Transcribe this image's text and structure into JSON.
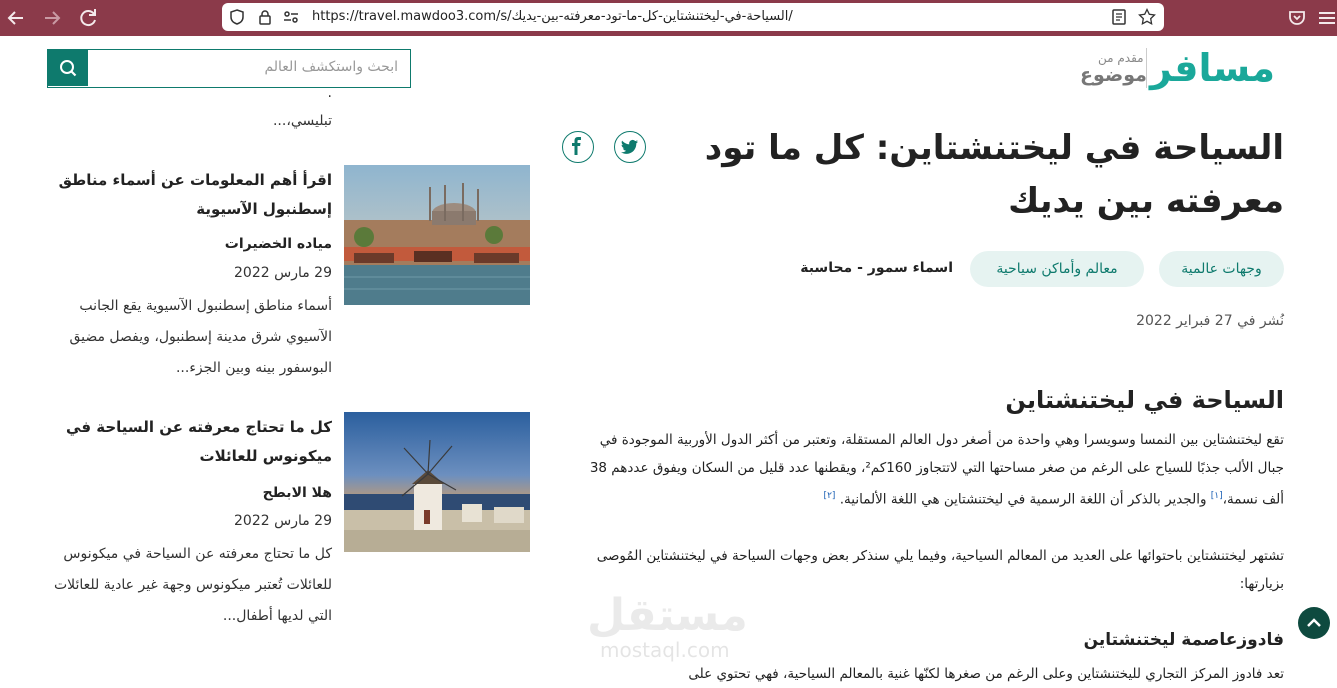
{
  "browser": {
    "url": "https://travel.mawdoo3.com/s/السياحة-في-ليختنشتاين-كل-ما-تود-معرفته-بين-يديك/"
  },
  "header": {
    "logo_main": "مسافر",
    "logo_sub_top": "مقدم من",
    "logo_sub_brand": "موضوع",
    "search_placeholder": "ابحث واستكشف العالم"
  },
  "article": {
    "title": "السياحة في ليختنشتاين: كل ما تود معرفته بين يديك",
    "tags": [
      "وجهات عالمية",
      "معالم وأماكن سياحية"
    ],
    "author": "اسماء سمور - محاسبة",
    "published": "نُشر في 27 فبراير 2022",
    "section_heading": "السياحة في ليختنشتاين",
    "para1": "تقع ليختنشتاين بين النمسا وسويسرا وهي واحدة من أصغر دول العالم المستقلة، وتعتبر من أكثر الدول الأوربية الموجودة في جبال الألب جذبًا للسياح على الرغم من صغر مساحتها التي لاتتجاوز 160كم²، ويقطنها عدد قليل من السكان ويفوق عددهم 38 ألف نسمة،",
    "ref1": "[١]",
    "para1_cont": " والجدير بالذكر أن اللغة الرسمية في ليختنشتاين هي اللغة الألمانية.",
    "ref2": "[٢]",
    "para2": "تشتهر ليختنشتاين باحتوائها على العديد من المعالم السياحية، وفيما يلي سنذكر بعض وجهات السياحة في ليختنشتاين المُوصى بزيارتها:",
    "subheading": "فادوزعاصمة ليختنشتاين",
    "para3": "تعد فادوز المركز التجاري لليختنشتاين وعلى الرغم من صغرها لكنّها غنية بالمعالم السياحية، فهي تحتوي على"
  },
  "sidebar": {
    "prev_dots": ".",
    "prev_excerpt_tail": "تبليسي،...",
    "cards": [
      {
        "title": "اقرأ أهم المعلومات عن أسماء مناطق إسطنبول الآسيوية",
        "author": "مياده الخضيرات",
        "date": "29 مارس 2022",
        "excerpt": "أسماء مناطق إسطنبول الآسيوية يقع الجانب الآسيوي شرق مدينة إسطنبول، ويفصل مضيق البوسفور بينه وبين الجزء..."
      },
      {
        "title": "كل ما تحتاج معرفته عن السياحة في ميكونوس للعائلات",
        "author": "هلا الابطح",
        "date": "29 مارس 2022",
        "excerpt": "كل ما تحتاج معرفته عن السياحة في ميكونوس للعائلات تُعتبر ميكونوس وجهة غير عادية للعائلات التي لديها أطفال..."
      }
    ]
  },
  "watermark": {
    "arabic": "مستقل",
    "latin": "mostaql.com"
  },
  "colors": {
    "accent": "#0e7a6d",
    "logo": "#1aa89a",
    "chrome": "#8b3a4a",
    "tag_bg": "#e6f3f1"
  },
  "icons": {
    "back": "arrow-left-icon",
    "forward": "arrow-right-icon",
    "reload": "reload-icon",
    "shield": "shield-icon",
    "lock": "lock-icon",
    "permissions": "permissions-icon",
    "reader": "reader-view-icon",
    "bookmark": "star-icon",
    "pocket": "pocket-icon",
    "menu": "menu-icon",
    "search": "search-icon",
    "facebook": "facebook-icon",
    "twitter": "twitter-icon",
    "scroll_top": "chevron-up-icon"
  }
}
